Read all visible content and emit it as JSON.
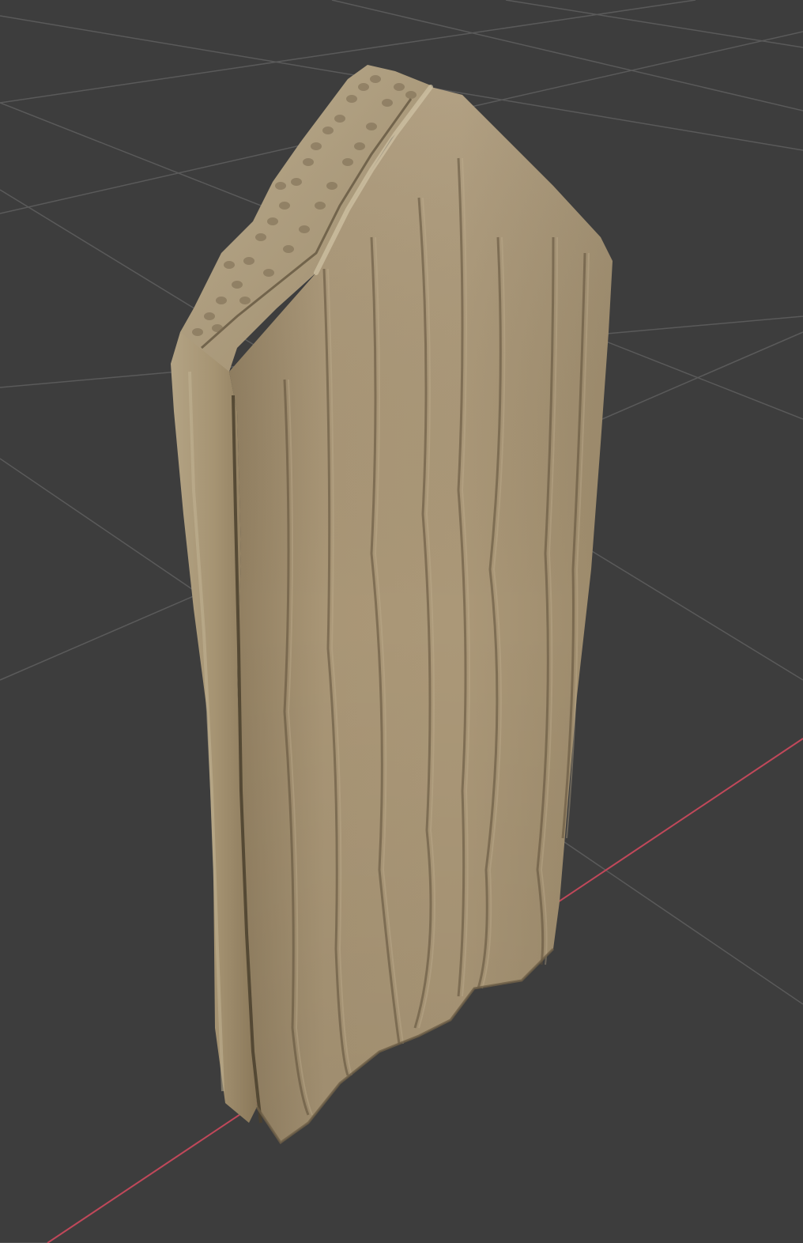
{
  "viewport": {
    "background_color": "#3d3d3d",
    "grid_line_color": "#5a5a5a",
    "x_axis_color": "#c0485a",
    "object_color": "#a99676",
    "object_highlight_color": "#c8b898",
    "object_shadow_color": "#6e5f47",
    "object_icon": "sculpted-wooden-plank-mesh"
  }
}
